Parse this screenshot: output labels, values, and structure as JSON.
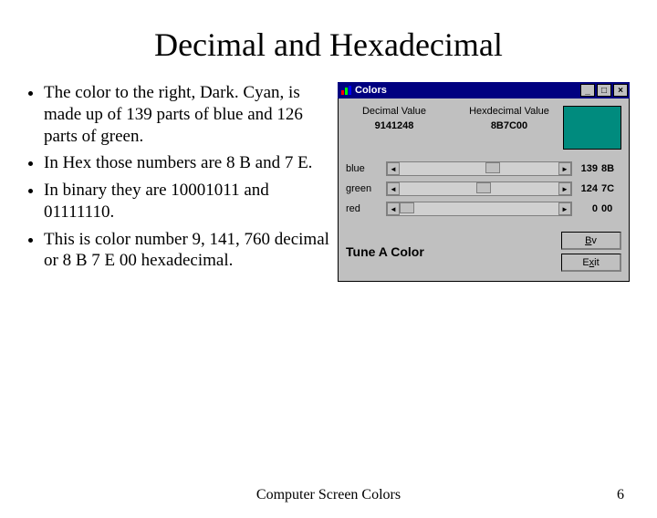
{
  "title": "Decimal and Hexadecimal",
  "bullets": [
    "The color to the right, Dark. Cyan, is made up of 139 parts of blue and 126 parts of green.",
    "In Hex those numbers are 8 B and 7 E.",
    "In binary they are 10001011 and 01111110.",
    "This is color number 9, 141, 760 decimal or 8 B 7 E 00 hexadecimal."
  ],
  "panel": {
    "title": "Colors",
    "decimal_label": "Decimal Value",
    "hex_label": "Hexdecimal Value",
    "decimal_value": "9141248",
    "hex_value": "8B7C00",
    "swatch_color": "#008b7e",
    "channels": [
      {
        "name": "blue",
        "value": "139",
        "hex": "8B",
        "pos": 54
      },
      {
        "name": "green",
        "value": "124",
        "hex": "7C",
        "pos": 48
      },
      {
        "name": "red",
        "value": "0",
        "hex": "00",
        "pos": 0
      }
    ],
    "tune_label": "Tune A Color",
    "button_bv": "Bv",
    "button_exit": "Exit"
  },
  "footer": {
    "center": "Computer Screen Colors",
    "page": "6"
  }
}
